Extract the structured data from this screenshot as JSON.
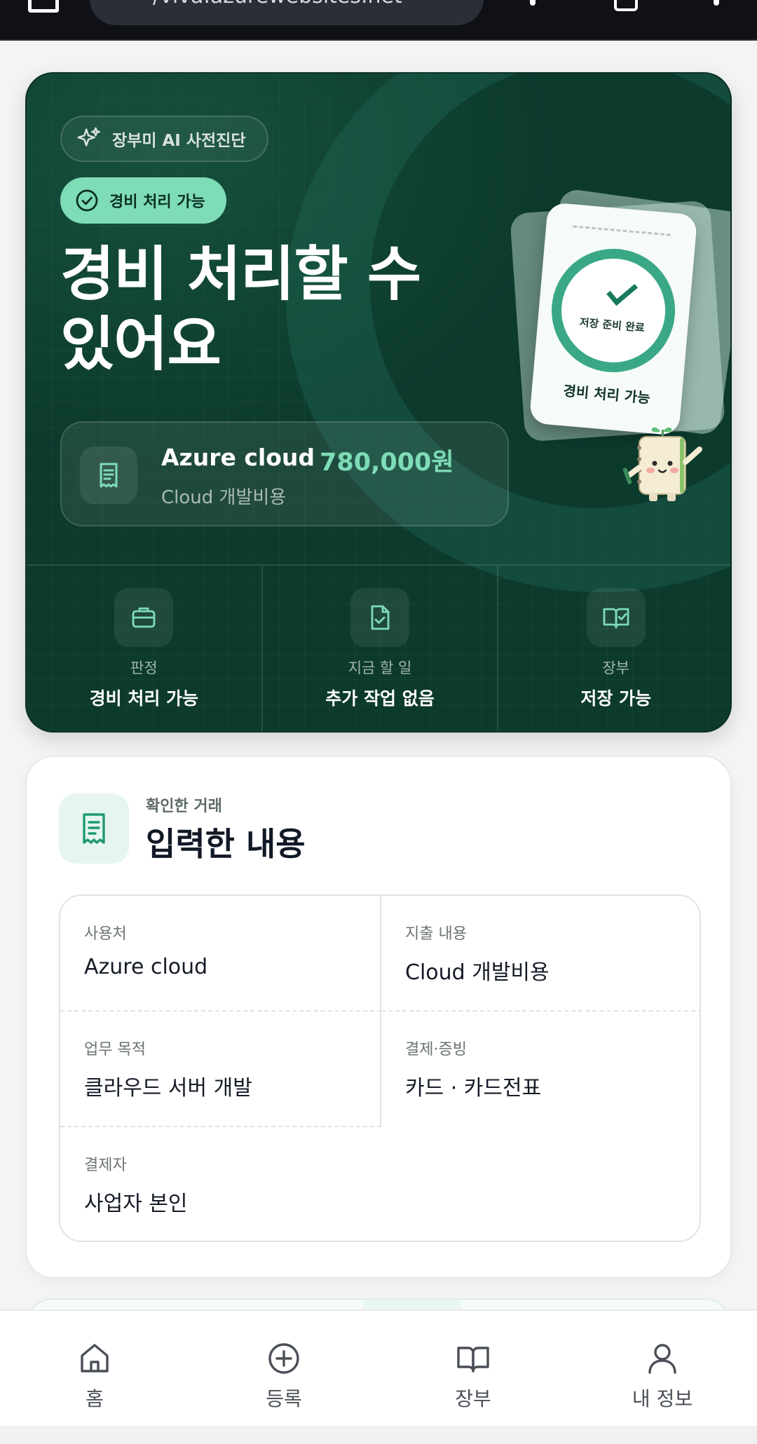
{
  "browser": {
    "url": "/viva.azurewebsites.net"
  },
  "hero": {
    "ai_chip": "장부미 AI 사전진단",
    "status_chip": "경비 처리 가능",
    "title_line1": "경비 처리할 수",
    "title_line2": "있어요",
    "summary": {
      "vendor": "Azure cloud",
      "amount": "780,000원",
      "description": "Cloud 개발비용"
    },
    "illustration": {
      "ring_label": "저장 준비 완료",
      "card_label": "경비 처리 가능"
    },
    "stats": [
      {
        "label": "판정",
        "value": "경비 처리 가능",
        "icon": "briefcase-icon"
      },
      {
        "label": "지금 할 일",
        "value": "추가 작업 없음",
        "icon": "document-check-icon"
      },
      {
        "label": "장부",
        "value": "저장 가능",
        "icon": "book-check-icon"
      }
    ]
  },
  "detail": {
    "kicker": "확인한 거래",
    "title": "입력한 내용",
    "fields": [
      {
        "label": "사용처",
        "value": "Azure cloud"
      },
      {
        "label": "지출 내용",
        "value": "Cloud 개발비용"
      },
      {
        "label": "업무 목적",
        "value": "클라우드 서버 개발"
      },
      {
        "label": "결제·증빙",
        "value": "카드 · 카드전표"
      },
      {
        "label": "결제자",
        "value": "사업자 본인"
      }
    ]
  },
  "nav": [
    {
      "label": "홈",
      "icon": "home-icon"
    },
    {
      "label": "등록",
      "icon": "plus-circle-icon"
    },
    {
      "label": "장부",
      "icon": "book-icon"
    },
    {
      "label": "내 정보",
      "icon": "user-icon"
    }
  ],
  "colors": {
    "hero_bg": "#0c3a2d",
    "accent": "#7edcb6",
    "ring": "#3aa886"
  }
}
